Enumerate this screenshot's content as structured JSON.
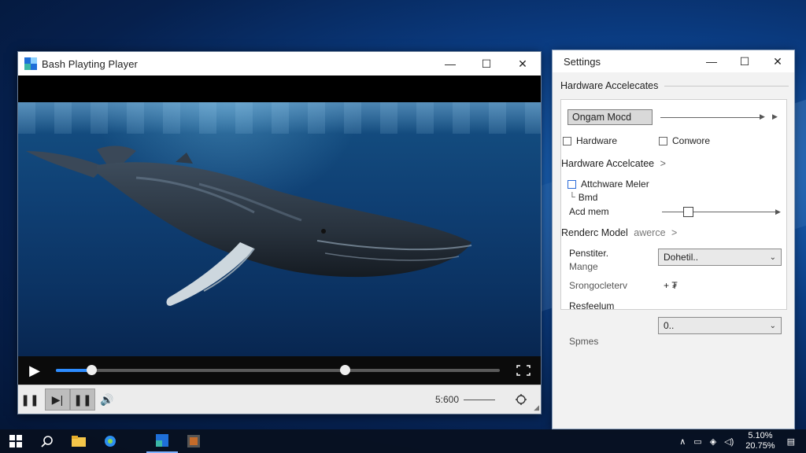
{
  "player": {
    "title": "Bash Playting Player",
    "controls": {
      "play": "▶",
      "pause": "❚❚",
      "next": "▶|",
      "pause2": "❚❚",
      "volume": "🔊",
      "time": "5:600"
    },
    "progress": {
      "played_fraction": 0.08,
      "buffer_thumb_fraction": 0.65
    }
  },
  "settings": {
    "title": "Settings",
    "section1": "Hardware Accelecates",
    "mode_button": "Ongam Mocd",
    "check_hardware": "Hardware",
    "check_conwore": "Conwore",
    "section2": "Hardware Accelcatee",
    "section2_arrow": ">",
    "check_attchware": "Attchware Meler",
    "check_bmd": "Bmd",
    "label_acd": "Acd mem",
    "slider_value_fraction": 0.22,
    "section3": "Renderc Model",
    "section3_note": "awerce",
    "section3_arrow": ">",
    "penstiter": "Penstiter.",
    "mange": "Mange",
    "select1_value": "Dohetil..",
    "strongocleterv": "Srongocleterv",
    "plus_symbol": "+ ₮",
    "resfeelum": "Resfeelum",
    "spmes": "Spmes",
    "select2_value": "0.."
  },
  "taskbar": {
    "clock_line1": "5.10%",
    "clock_line2": "20.75%"
  },
  "window_buttons": {
    "minimize": "—",
    "maximize": "☐",
    "close": "✕"
  }
}
